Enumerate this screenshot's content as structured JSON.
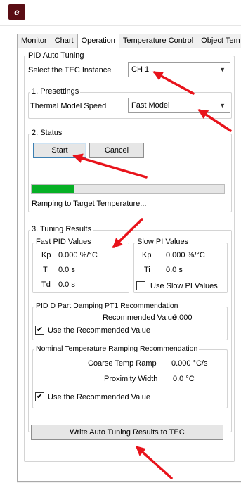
{
  "app": {
    "logo_text": "e"
  },
  "tabs": [
    {
      "label": "Monitor"
    },
    {
      "label": "Chart"
    },
    {
      "label": "Operation"
    },
    {
      "label": "Temperature Control"
    },
    {
      "label": "Object Tem"
    }
  ],
  "pid_auto_tuning": {
    "title": "PID Auto Tuning",
    "instance_label": "Select the TEC Instance",
    "instance_value": "CH 1",
    "presettings": {
      "title": "1. Presettings",
      "model_label": "Thermal Model Speed",
      "model_value": "Fast Model"
    },
    "status": {
      "title": "2. Status",
      "start_label": "Start",
      "cancel_label": "Cancel",
      "progress": 0.22,
      "status_text": "Ramping to Target Temperature..."
    },
    "tuning_results": {
      "title": "3. Tuning Results",
      "fast_pid": {
        "title": "Fast PID Values",
        "kp_label": "Kp",
        "kp_value": "0.000 %/°C",
        "ti_label": "Ti",
        "ti_value": "0.0 s",
        "td_label": "Td",
        "td_value": "0.0 s"
      },
      "slow_pi": {
        "title": "Slow PI Values",
        "kp_label": "Kp",
        "kp_value": "0.000 %/°C",
        "ti_label": "Ti",
        "ti_value": "0.0 s",
        "use_label": "Use Slow PI Values",
        "use_checked": false
      },
      "pid_d": {
        "title": "PID D Part Damping PT1 Recommendation",
        "rec_label": "Recommended Value",
        "rec_value": "0.000",
        "use_label": "Use the Recommended Value",
        "use_checked": true
      },
      "ramping": {
        "title": "Nominal Temperature Ramping Recommendation",
        "coarse_label": "Coarse Temp Ramp",
        "coarse_value": "0.000 °C/s",
        "proximity_label": "Proximity Width",
        "proximity_value": "0.0 °C",
        "use_label": "Use the Recommended Value",
        "use_checked": true
      },
      "write_label": "Write Auto Tuning Results to TEC"
    }
  },
  "colors": {
    "annotation_arrow": "#e8131b",
    "progress_fill": "#06b025",
    "logo_bg": "#5a0d14"
  },
  "icons": {
    "dropdown": "chevron-down-icon",
    "check": "checkmark-icon"
  }
}
